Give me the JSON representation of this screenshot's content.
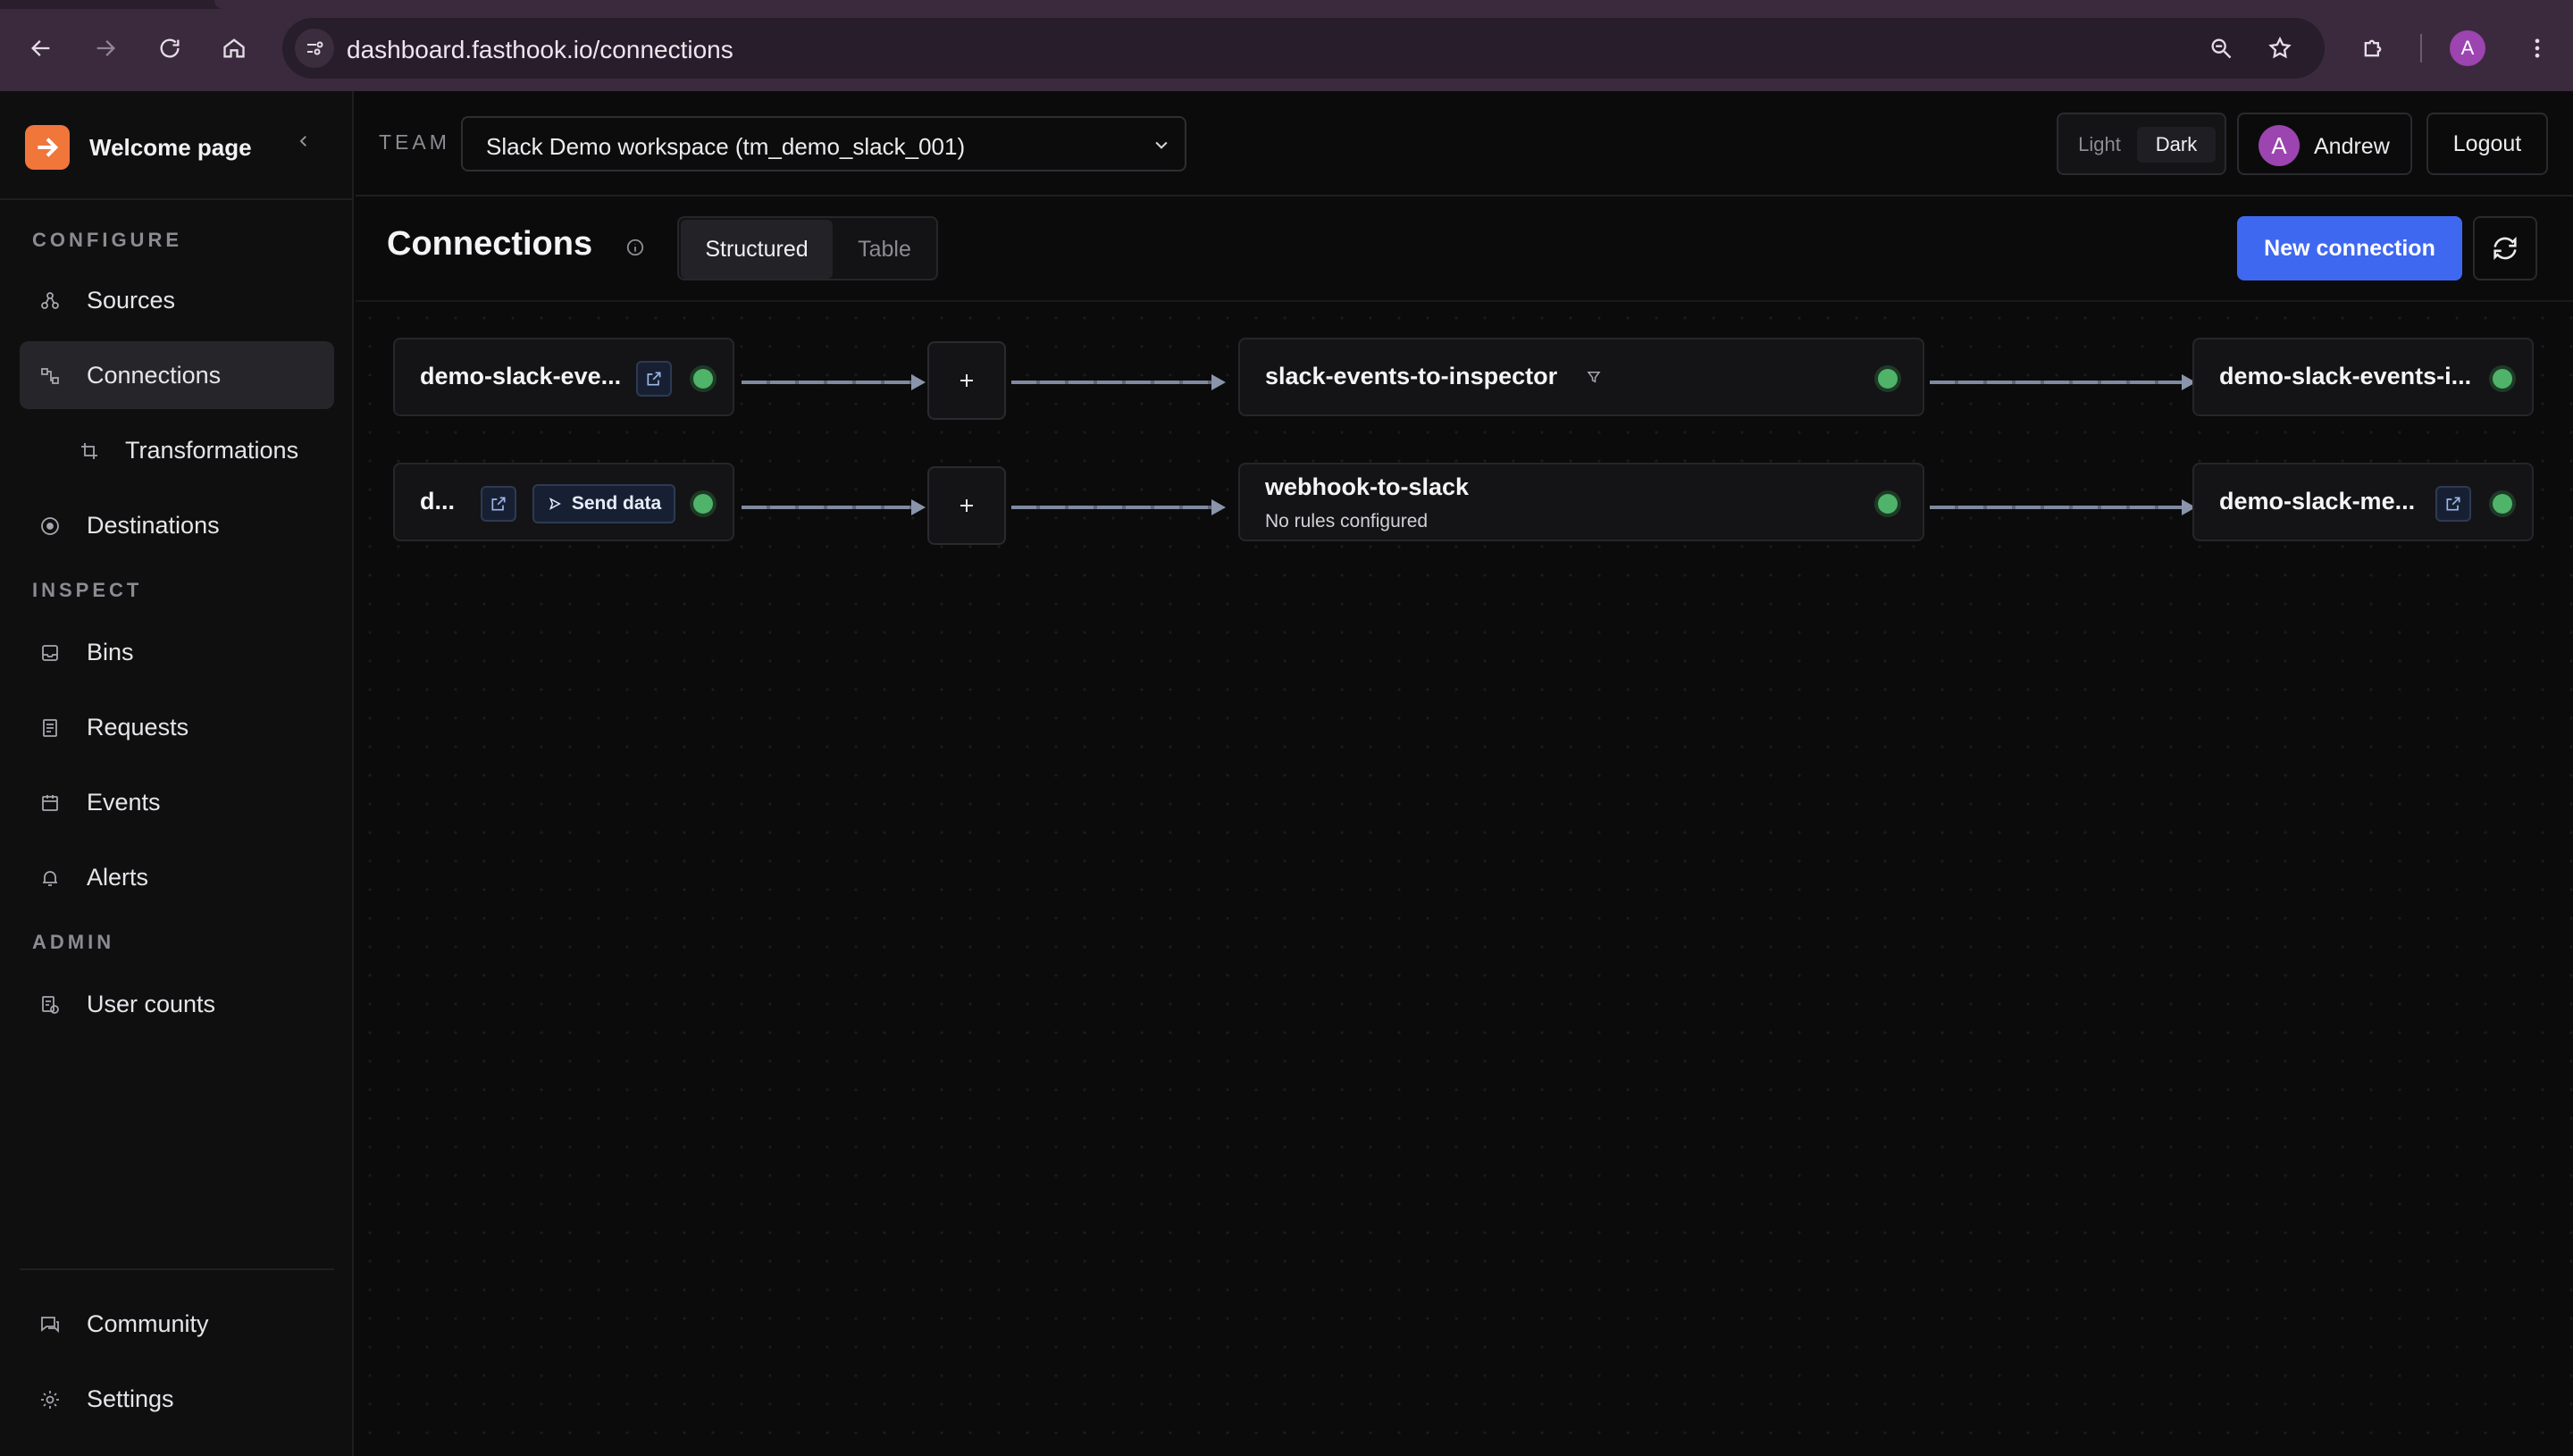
{
  "browser": {
    "url": "dashboard.fasthook.io/connections",
    "profile_initial": "A"
  },
  "sidebar": {
    "brand": "Welcome page",
    "sections": {
      "configure": "CONFIGURE",
      "inspect": "INSPECT",
      "admin": "ADMIN"
    },
    "items": {
      "sources": "Sources",
      "connections": "Connections",
      "transformations": "Transformations",
      "destinations": "Destinations",
      "bins": "Bins",
      "requests": "Requests",
      "events": "Events",
      "alerts": "Alerts",
      "user_counts": "User counts",
      "community": "Community",
      "settings": "Settings"
    },
    "active": "connections"
  },
  "topbar": {
    "team_label": "TEAM",
    "team_value": "Slack Demo workspace (tm_demo_slack_001)",
    "theme_light": "Light",
    "theme_dark": "Dark",
    "theme_selected": "Dark",
    "user_initial": "A",
    "user_name": "Andrew",
    "logout": "Logout"
  },
  "page": {
    "title": "Connections",
    "view_structured": "Structured",
    "view_table": "Table",
    "view_selected": "Structured",
    "new_connection": "New connection"
  },
  "connections": [
    {
      "source": "demo-slack-eve...",
      "connection": "slack-events-to-inspector",
      "rules": "",
      "destination": "demo-slack-events-i..."
    },
    {
      "source": "d...",
      "send_data": "Send data",
      "connection": "webhook-to-slack",
      "rules": "No rules configured",
      "destination": "demo-slack-me..."
    }
  ],
  "colors": {
    "accent": "#3f68f0",
    "brand": "#f0763a",
    "status_ok": "#4fb36a",
    "avatar": "#9c44b0"
  }
}
